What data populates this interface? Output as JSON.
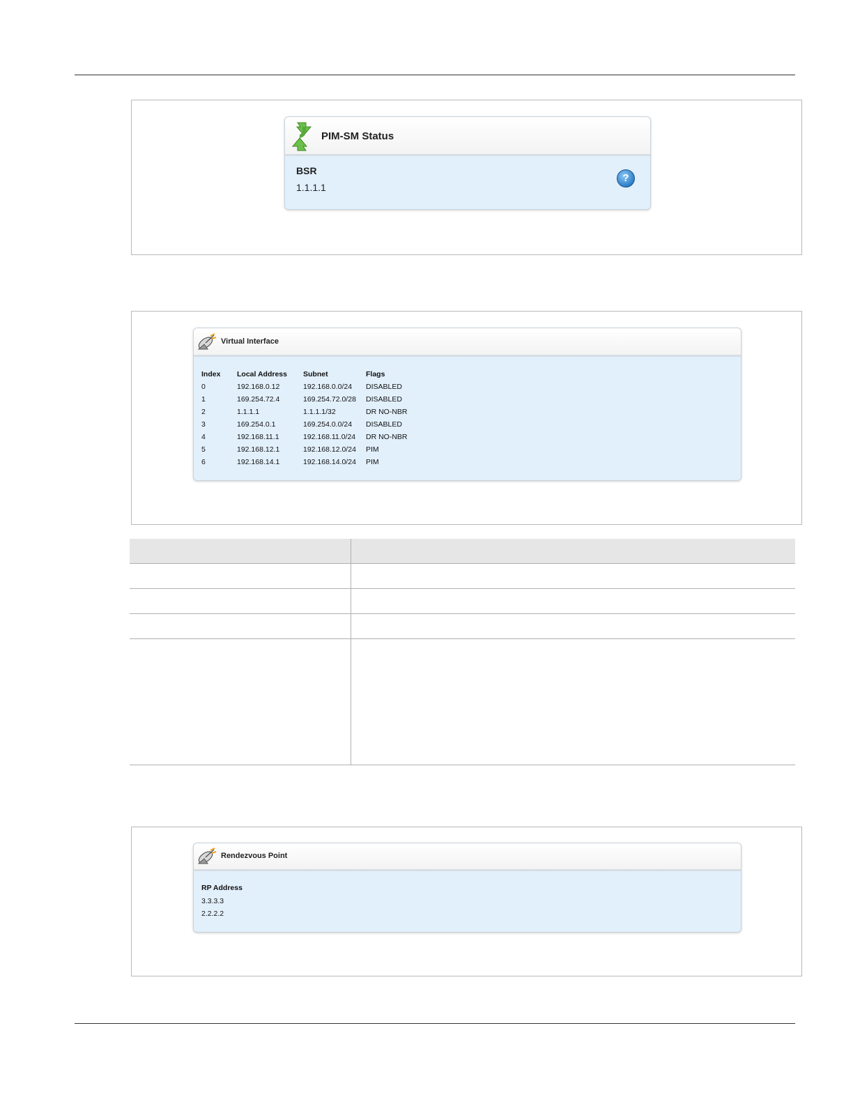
{
  "figures": {
    "pim_sm_status": {
      "title": "PIM-SM Status",
      "icon": "green-refresh-arrows-icon",
      "bsr_label": "BSR",
      "bsr_value": "1.1.1.1",
      "help_icon": "help-icon",
      "help_glyph": "?"
    },
    "virtual_interface": {
      "title": "Virtual Interface",
      "icon": "satellite-dish-icon",
      "columns": [
        "Index",
        "Local Address",
        "Subnet",
        "Flags"
      ],
      "rows": [
        [
          "0",
          "192.168.0.12",
          "192.168.0.0/24",
          "DISABLED"
        ],
        [
          "1",
          "169.254.72.4",
          "169.254.72.0/28",
          "DISABLED"
        ],
        [
          "2",
          "1.1.1.1",
          "1.1.1.1/32",
          "DR NO-NBR"
        ],
        [
          "3",
          "169.254.0.1",
          "169.254.0.0/24",
          "DISABLED"
        ],
        [
          "4",
          "192.168.11.1",
          "192.168.11.0/24",
          "DR NO-NBR"
        ],
        [
          "5",
          "192.168.12.1",
          "192.168.12.0/24",
          "PIM"
        ],
        [
          "6",
          "192.168.14.1",
          "192.168.14.0/24",
          "PIM"
        ]
      ]
    },
    "rendezvous_point": {
      "title": "Rendezvous Point",
      "icon": "satellite-dish-icon",
      "column": "RP Address",
      "rows": [
        "3.3.3.3",
        "2.2.2.2"
      ]
    }
  },
  "parameter_table": {
    "header": [
      "",
      ""
    ],
    "rows": [
      [
        "",
        ""
      ],
      [
        "",
        ""
      ],
      [
        "",
        ""
      ],
      [
        "",
        ""
      ]
    ]
  }
}
